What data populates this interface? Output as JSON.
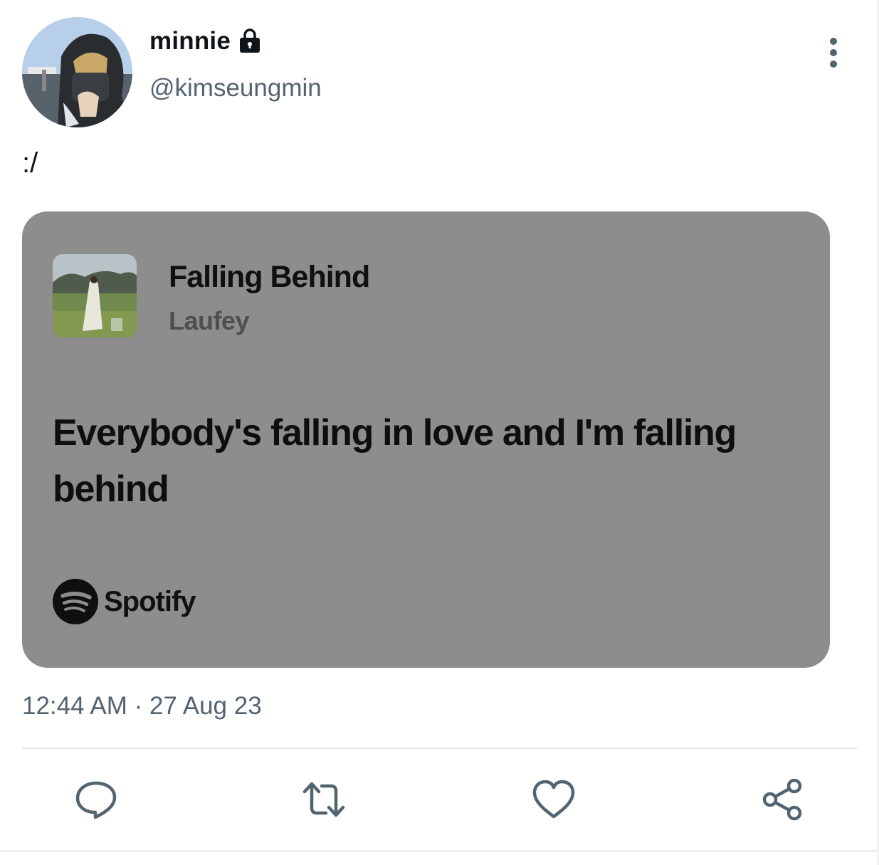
{
  "tweet": {
    "display_name": "minnie",
    "handle": "@kimseungmin",
    "text": ":/",
    "time": "12:44 AM",
    "separator": " · ",
    "date": "27 Aug 23"
  },
  "card": {
    "track_title": "Falling Behind",
    "artist": "Laufey",
    "lyric": "Everybody's falling in love and I'm falling behind",
    "brand": "Spotify",
    "background_color": "#8d8d8d"
  },
  "icons": {
    "protected": "lock-icon",
    "more": "more-vertical-icon",
    "reply": "reply-icon",
    "retweet": "retweet-icon",
    "like": "heart-icon",
    "share": "share-icon"
  },
  "colors": {
    "secondary_text": "#536471",
    "icon_color": "#536471"
  }
}
